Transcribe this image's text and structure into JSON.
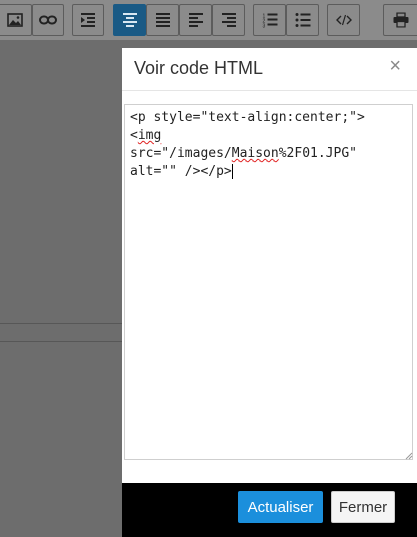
{
  "toolbar": {
    "buttons": [
      {
        "name": "image-icon"
      },
      {
        "name": "link-icon"
      },
      {
        "name": "indent-icon"
      },
      {
        "name": "align-center-icon",
        "active": true
      },
      {
        "name": "align-justify-icon"
      },
      {
        "name": "align-left-icon"
      },
      {
        "name": "align-right-icon"
      },
      {
        "name": "ordered-list-icon"
      },
      {
        "name": "unordered-list-icon"
      },
      {
        "name": "code-icon"
      },
      {
        "name": "print-icon"
      }
    ],
    "active_color": "#1a5a85"
  },
  "modal": {
    "title": "Voir code HTML",
    "close": "×",
    "code": {
      "line1": "<p style=\"text-align:center;\">",
      "line2_prefix": "<",
      "line2_word": "img",
      "line3_a": "src=\"/images/",
      "line3_word": "Maison",
      "line3_b": "%2F01.JPG\"",
      "line4": "alt=\"\" /></p>"
    },
    "update_button": "Actualiser",
    "close_button": "Fermer",
    "accent_color": "#1b8fdc"
  }
}
